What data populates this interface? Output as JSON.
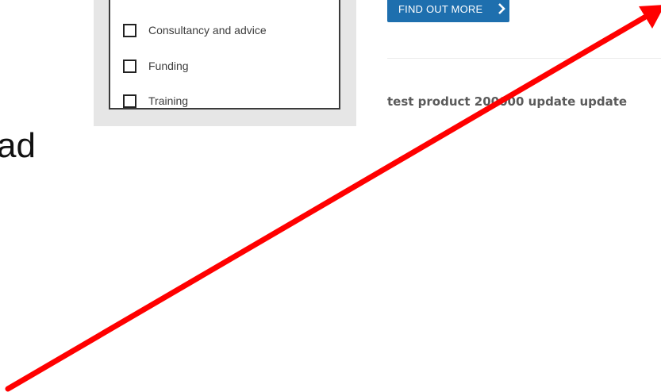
{
  "filters": {
    "items": [
      {
        "label": "Consultancy and advice",
        "checked": false
      },
      {
        "label": "Funding",
        "checked": false
      },
      {
        "label": "Training",
        "checked": false
      }
    ]
  },
  "cta": {
    "label": "FIND OUT MORE",
    "icon": "chevron-right-icon",
    "color": "#1e6fae"
  },
  "product": {
    "title": "test product 200000 update update"
  },
  "fragment": {
    "text": "ad"
  },
  "annotation": {
    "type": "arrow",
    "icon": "red-arrow-icon",
    "color": "#ff0000"
  }
}
